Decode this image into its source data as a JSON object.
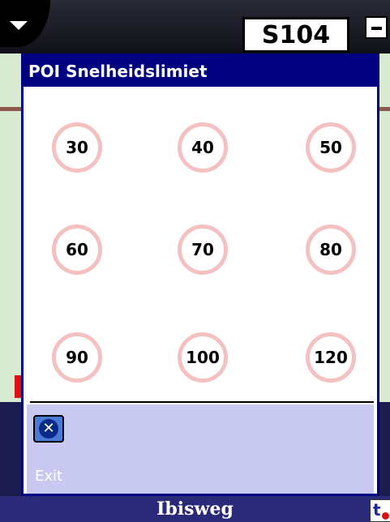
{
  "header": {
    "road_number": "S104"
  },
  "dialog": {
    "title": "POI Snelheidslimiet",
    "speed_limits": [
      "30",
      "40",
      "50",
      "60",
      "70",
      "80",
      "90",
      "100",
      "120"
    ],
    "sign_colors": {
      "ring": "#f4c0c0",
      "face": "#ffffff"
    },
    "exit_label": "Exit"
  },
  "status": {
    "street_name": "Ibisweg"
  },
  "colors": {
    "title_bar": "#000080",
    "footer": "#c8c8f0",
    "street_bar": "#2a2a78"
  },
  "icons": {
    "menu": "chevron-down-icon",
    "minimize": "minimize-icon",
    "exit": "close-icon",
    "corner": "traffic-icon"
  }
}
